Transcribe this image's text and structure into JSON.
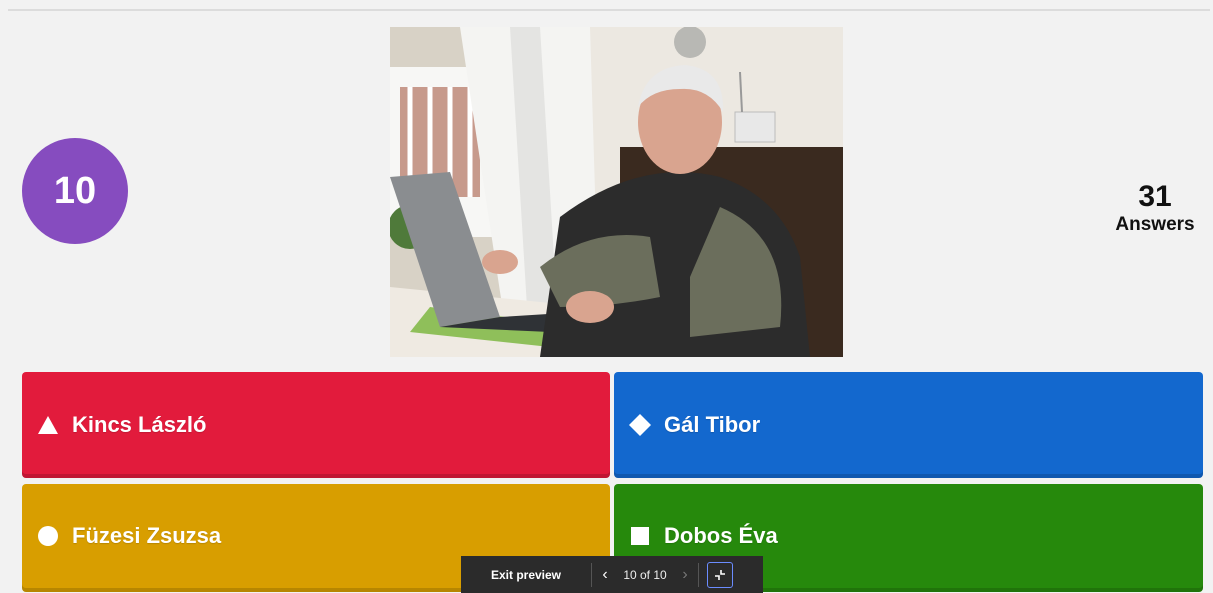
{
  "question": {
    "timer": "10",
    "answers_count": "31",
    "answers_label": "Answers"
  },
  "options": [
    {
      "label": "Kincs László",
      "shape": "triangle-icon",
      "color": "#e21b3c"
    },
    {
      "label": "Gál Tibor",
      "shape": "diamond-icon",
      "color": "#1368ce"
    },
    {
      "label": "Füzesi Zsuzsa",
      "shape": "circle-icon",
      "color": "#d89e00"
    },
    {
      "label": "Dobos Éva",
      "shape": "square-icon",
      "color": "#26890c"
    }
  ],
  "preview_bar": {
    "exit_label": "Exit preview",
    "pager": "10 of 10"
  },
  "colors": {
    "timer_bg": "#864cbf",
    "background": "#f2f2f2"
  }
}
